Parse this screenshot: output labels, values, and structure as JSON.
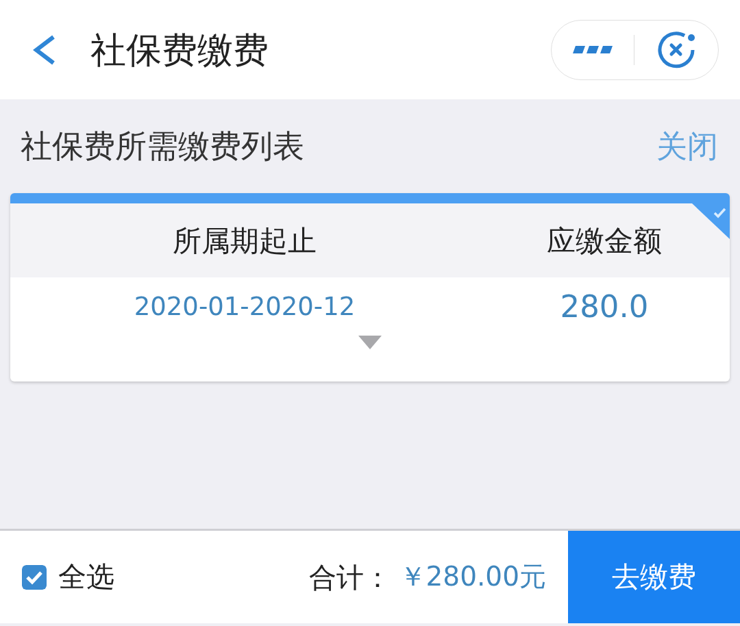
{
  "header": {
    "title": "社保费缴费"
  },
  "list_header": {
    "title": "社保费所需缴费列表",
    "close_link": "关闭"
  },
  "table": {
    "columns": [
      "所属期起止",
      "应缴金额"
    ],
    "rows": [
      {
        "period": "2020-01-2020-12",
        "amount": "280.0",
        "selected": true,
        "expanded": false
      }
    ]
  },
  "footer": {
    "select_all": {
      "label": "全选",
      "checked": true
    },
    "total_label": "合计：",
    "total_value": "￥280.00元",
    "pay_button": "去缴费"
  }
}
